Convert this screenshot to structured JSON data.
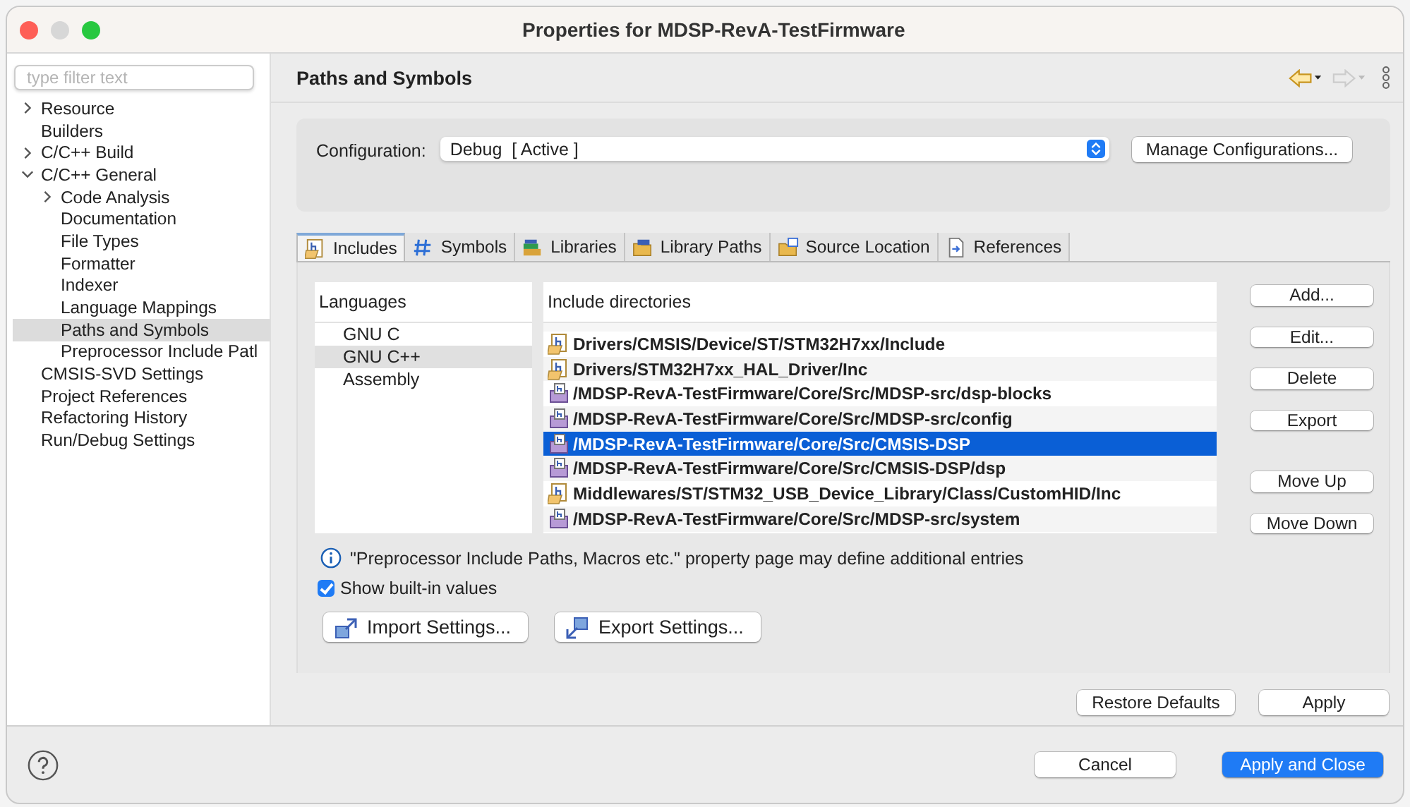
{
  "window": {
    "title": "Properties for MDSP-RevA-TestFirmware"
  },
  "filter": {
    "placeholder": "type filter text"
  },
  "sidebar": {
    "items": [
      {
        "label": "Resource",
        "expanded": false,
        "selected": false
      },
      {
        "label": "Builders",
        "selected": false
      },
      {
        "label": "C/C++ Build",
        "expanded": false,
        "selected": false
      },
      {
        "label": "C/C++ General",
        "expanded": true,
        "selected": false,
        "children": [
          {
            "label": "Code Analysis",
            "expanded": false,
            "selected": false
          },
          {
            "label": "Documentation",
            "selected": false
          },
          {
            "label": "File Types",
            "selected": false
          },
          {
            "label": "Formatter",
            "selected": false
          },
          {
            "label": "Indexer",
            "selected": false
          },
          {
            "label": "Language Mappings",
            "selected": false
          },
          {
            "label": "Paths and Symbols",
            "selected": true
          },
          {
            "label": "Preprocessor Include Patl",
            "selected": false
          }
        ]
      },
      {
        "label": "CMSIS-SVD Settings",
        "selected": false
      },
      {
        "label": "Project References",
        "selected": false
      },
      {
        "label": "Refactoring History",
        "selected": false
      },
      {
        "label": "Run/Debug Settings",
        "selected": false
      }
    ]
  },
  "page": {
    "title": "Paths and Symbols"
  },
  "configuration": {
    "label": "Configuration:",
    "value": "Debug  [ Active ]",
    "button": "Manage Configurations..."
  },
  "tabs": [
    {
      "label": "Includes",
      "kind": "includes",
      "selected": true
    },
    {
      "label": "Symbols",
      "kind": "symbols",
      "selected": false
    },
    {
      "label": "Libraries",
      "kind": "libraries",
      "selected": false
    },
    {
      "label": "Library Paths",
      "kind": "library-paths",
      "selected": false
    },
    {
      "label": "Source Location",
      "kind": "source",
      "selected": false
    },
    {
      "label": "References",
      "kind": "references",
      "selected": false
    }
  ],
  "languages": {
    "header": "Languages",
    "items": [
      {
        "label": "GNU C",
        "selected": false
      },
      {
        "label": "GNU C++",
        "selected": true
      },
      {
        "label": "Assembly",
        "selected": false
      }
    ]
  },
  "include_directories": {
    "header": "Include directories",
    "rows": [
      {
        "path": "Drivers/CMSIS/Device/ST/STM32H7xx/Include",
        "kind": "folder",
        "selected": false
      },
      {
        "path": "Drivers/STM32H7xx_HAL_Driver/Inc",
        "kind": "folder",
        "selected": false
      },
      {
        "path": "/MDSP-RevA-TestFirmware/Core/Src/MDSP-src/dsp-blocks",
        "kind": "workspace",
        "selected": false
      },
      {
        "path": "/MDSP-RevA-TestFirmware/Core/Src/MDSP-src/config",
        "kind": "workspace",
        "selected": false
      },
      {
        "path": "/MDSP-RevA-TestFirmware/Core/Src/CMSIS-DSP",
        "kind": "workspace",
        "selected": true
      },
      {
        "path": "/MDSP-RevA-TestFirmware/Core/Src/CMSIS-DSP/dsp",
        "kind": "workspace",
        "selected": false
      },
      {
        "path": "Middlewares/ST/STM32_USB_Device_Library/Class/CustomHID/Inc",
        "kind": "folder",
        "selected": false
      },
      {
        "path": "/MDSP-RevA-TestFirmware/Core/Src/MDSP-src/system",
        "kind": "workspace",
        "selected": false
      }
    ]
  },
  "side_buttons": [
    {
      "label": "Add...",
      "gap": false
    },
    {
      "label": "Edit...",
      "gap": false
    },
    {
      "label": "Delete",
      "gap": false
    },
    {
      "label": "Export",
      "gap": false
    },
    {
      "label": "Move Up",
      "gap": true
    },
    {
      "label": "Move Down",
      "gap": false
    }
  ],
  "info": "\"Preprocessor Include Paths, Macros etc.\" property page may define additional entries",
  "show_builtin": {
    "label": "Show built-in values",
    "checked": true
  },
  "settings_buttons": [
    "Import Settings...",
    "Export Settings..."
  ],
  "page_buttons": [
    "Restore Defaults",
    "Apply"
  ],
  "dialog_buttons": [
    {
      "label": "Cancel",
      "default": false
    },
    {
      "label": "Apply and Close",
      "default": true
    }
  ]
}
